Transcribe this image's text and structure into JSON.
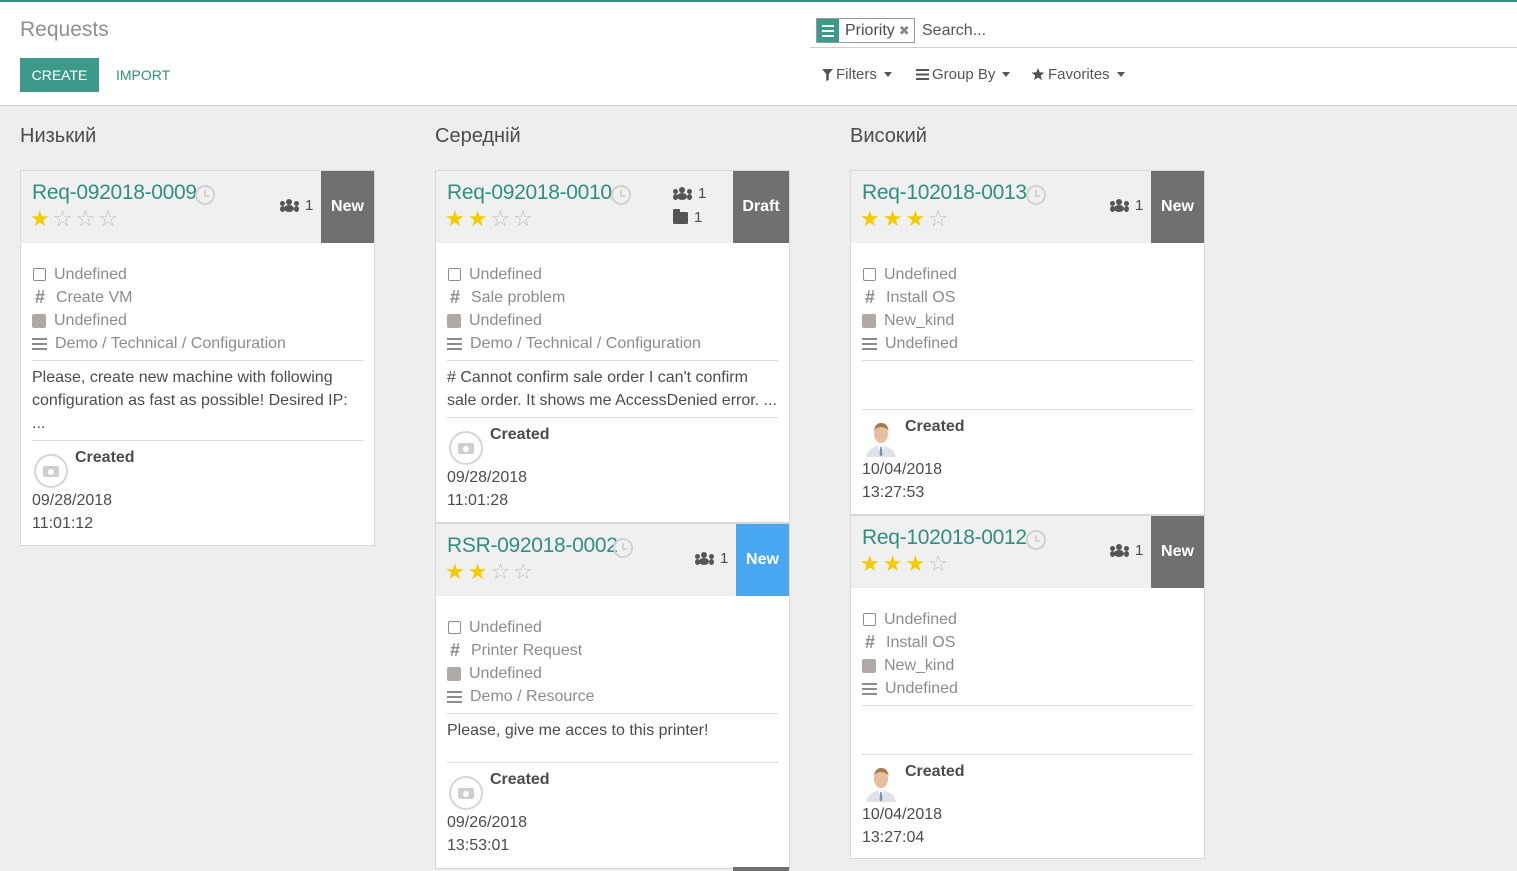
{
  "header": {
    "title": "Requests",
    "create_label": "CREATE",
    "import_label": "IMPORT"
  },
  "search": {
    "facet_label": "Priority",
    "facet_remove": "✖",
    "placeholder": "Search...",
    "filters_label": "Filters",
    "groupby_label": "Group By",
    "favorites_label": "Favorites"
  },
  "colors": {
    "accent": "#2f8f80",
    "primary_button": "#3d9a8a",
    "badge_gray": "#707070",
    "badge_blue": "#4aa7f1",
    "star_on": "#f3cc00"
  },
  "columns": [
    {
      "title": "Низький",
      "cards": [
        {
          "ref": "Req-092018-0009",
          "stars": 1,
          "users": "1",
          "stage": "New",
          "fields": [
            "Undefined",
            "Create VM",
            "Undefined",
            "Demo / Technical / Configuration"
          ],
          "description": "Please, create new machine with following configuration as fast as possible! Desired IP: ...",
          "created_label": "Created",
          "created_date": "09/28/2018",
          "created_time": "11:01:12"
        }
      ]
    },
    {
      "title": "Середній",
      "cards": [
        {
          "ref": "Req-092018-0010",
          "stars": 2,
          "users": "1",
          "folders": "1",
          "stage": "Draft",
          "fields": [
            "Undefined",
            "Sale problem",
            "Undefined",
            "Demo / Technical / Configuration"
          ],
          "description": "# Cannot confirm sale order I can't confirm sale order. It shows me AccessDenied error. ...",
          "created_label": "Created",
          "created_date": "09/28/2018",
          "created_time": "11:01:28"
        },
        {
          "ref": "RSR-092018-0002",
          "stars": 2,
          "users": "1",
          "stage": "New",
          "fields": [
            "Undefined",
            "Printer Request",
            "Undefined",
            "Demo / Resource"
          ],
          "description": "Please, give me acces to this printer!",
          "created_label": "Created",
          "created_date": "09/26/2018",
          "created_time": "13:53:01"
        }
      ]
    },
    {
      "title": "Високий",
      "cards": [
        {
          "ref": "Req-102018-0013",
          "stars": 3,
          "users": "1",
          "stage": "New",
          "fields": [
            "Undefined",
            "Install OS",
            "New_kind",
            "Undefined"
          ],
          "created_label": "Created",
          "created_date": "10/04/2018",
          "created_time": "13:27:53"
        },
        {
          "ref": "Req-102018-0012",
          "stars": 3,
          "users": "1",
          "stage": "New",
          "fields": [
            "Undefined",
            "Install OS",
            "New_kind",
            "Undefined"
          ],
          "created_label": "Created",
          "created_date": "10/04/2018",
          "created_time": "13:27:04"
        }
      ]
    }
  ]
}
